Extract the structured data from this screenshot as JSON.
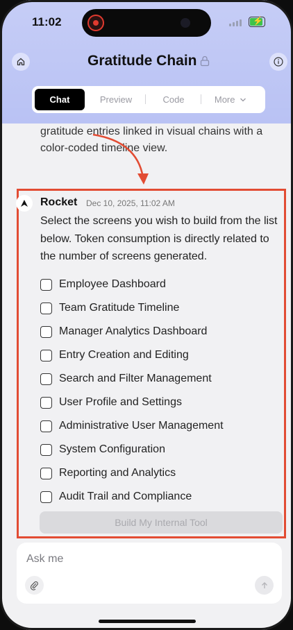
{
  "status": {
    "time": "11:02"
  },
  "header": {
    "title": "Gratitude Chain",
    "tabs": [
      {
        "label": "Chat"
      },
      {
        "label": "Preview"
      },
      {
        "label": "Code"
      },
      {
        "label": "More"
      }
    ]
  },
  "previous_message": {
    "text": "gratitude entries linked in visual chains with a color-coded timeline view."
  },
  "message": {
    "sender": "Rocket",
    "timestamp": "Dec 10, 2025, 11:02 AM",
    "text": "Select the screens you wish to build from the list below. Token consumption is directly related to the number of screens generated.",
    "options": [
      {
        "label": "Employee Dashboard",
        "checked": false
      },
      {
        "label": "Team Gratitude Timeline",
        "checked": false
      },
      {
        "label": "Manager Analytics Dashboard",
        "checked": false
      },
      {
        "label": "Entry Creation and Editing",
        "checked": false
      },
      {
        "label": "Search and Filter Management",
        "checked": false
      },
      {
        "label": "User Profile and Settings",
        "checked": false
      },
      {
        "label": "Administrative User Management",
        "checked": false
      },
      {
        "label": "System Configuration",
        "checked": false
      },
      {
        "label": "Reporting and Analytics",
        "checked": false
      },
      {
        "label": "Audit Trail and Compliance",
        "checked": false
      }
    ],
    "build_label": "Build My Internal Tool"
  },
  "composer": {
    "placeholder": "Ask me"
  },
  "colors": {
    "header_bg": "#c0c8f5",
    "highlight_border": "#e24c33",
    "active_tab": "#000000"
  }
}
